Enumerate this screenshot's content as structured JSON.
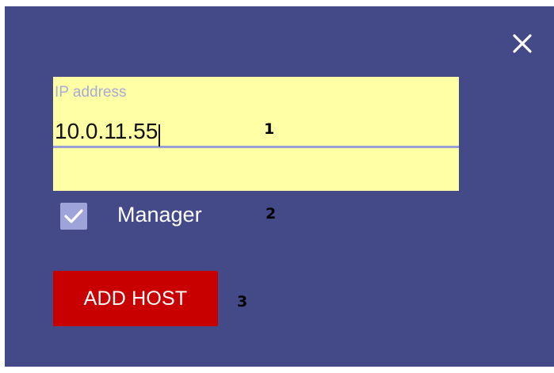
{
  "dialog": {
    "close_icon": "close-icon",
    "colors": {
      "background": "#434a87",
      "field_background": "#ffffa6",
      "field_underline": "#9aa0d6",
      "checkbox_fill": "#9ea3d9",
      "button_background": "#c90000"
    }
  },
  "ip_field": {
    "label": "IP address",
    "value": "10.0.11.55"
  },
  "manager_checkbox": {
    "label": "Manager",
    "checked": true,
    "icon": "checkmark-icon"
  },
  "add_host_button": {
    "label": "ADD HOST"
  },
  "annotations": {
    "one": "1",
    "two": "2",
    "three": "3"
  }
}
